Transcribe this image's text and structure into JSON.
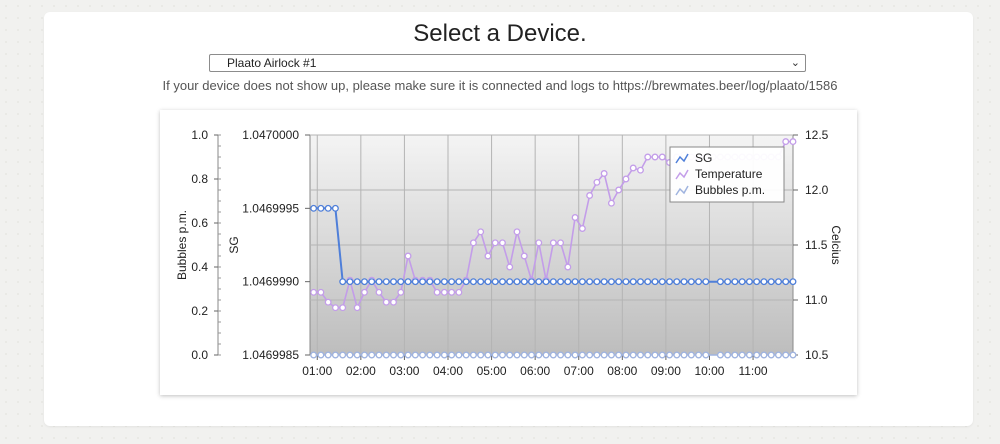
{
  "page": {
    "title": "Select a Device.",
    "device_select": {
      "selected": "Plaato Airlock #1"
    },
    "hint": "If your device does not show up, please make sure it is connected and logs to https://brewmates.beer/log/plaato/1586"
  },
  "colors": {
    "sg": "#4f7fd9",
    "temperature": "#c39de9",
    "bubbles": "#9fb3df",
    "plot_bg_top": "#f4f4f4",
    "plot_bg_bottom": "#bdbdbd"
  },
  "chart_data": {
    "type": "line",
    "x_ticks": [
      "01:00",
      "02:00",
      "03:00",
      "04:00",
      "05:00",
      "06:00",
      "07:00",
      "08:00",
      "09:00",
      "10:00",
      "11:00"
    ],
    "xlim": [
      "00:50",
      "11:55"
    ],
    "axes": {
      "bubbles": {
        "label": "Bubbles p.m.",
        "ylim": [
          0.0,
          1.0
        ],
        "ticks": [
          "0.0",
          "0.2",
          "0.4",
          "0.6",
          "0.8",
          "1.0"
        ]
      },
      "sg": {
        "label": "SG",
        "ylim": [
          1.0469985,
          1.047
        ],
        "ticks": [
          "1.0469985",
          "1.0469990",
          "1.0469995",
          "1.0470000"
        ]
      },
      "temperature": {
        "label": "Celcius",
        "ylim": [
          10.5,
          12.5
        ],
        "ticks": [
          "10.5",
          "11.0",
          "11.5",
          "12.0",
          "12.5"
        ]
      }
    },
    "legend": {
      "position": "top-right",
      "entries": [
        "SG",
        "Temperature",
        "Bubbles p.m."
      ]
    },
    "grid": true,
    "series": [
      {
        "name": "SG",
        "axis": "sg",
        "x": [
          "00:55",
          "01:05",
          "01:15",
          "01:25",
          "01:35",
          "01:45",
          "01:55",
          "02:05",
          "02:15",
          "02:25",
          "02:35",
          "02:45",
          "02:55",
          "03:05",
          "03:15",
          "03:25",
          "03:35",
          "03:45",
          "03:55",
          "04:05",
          "04:15",
          "04:25",
          "04:35",
          "04:45",
          "04:55",
          "05:05",
          "05:15",
          "05:25",
          "05:35",
          "05:45",
          "05:55",
          "06:05",
          "06:15",
          "06:25",
          "06:35",
          "06:45",
          "06:55",
          "07:05",
          "07:15",
          "07:25",
          "07:35",
          "07:45",
          "07:55",
          "08:05",
          "08:15",
          "08:25",
          "08:35",
          "08:45",
          "08:55",
          "09:05",
          "09:15",
          "09:25",
          "09:35",
          "09:45",
          "09:55",
          "10:15",
          "10:25",
          "10:35",
          "10:45",
          "10:55",
          "11:05",
          "11:15",
          "11:25",
          "11:35",
          "11:45",
          "11:55"
        ],
        "values": [
          1.0469995,
          1.0469995,
          1.0469995,
          1.0469995,
          1.046999,
          1.046999,
          1.046999,
          1.046999,
          1.046999,
          1.046999,
          1.046999,
          1.046999,
          1.046999,
          1.046999,
          1.046999,
          1.046999,
          1.046999,
          1.046999,
          1.046999,
          1.046999,
          1.046999,
          1.046999,
          1.046999,
          1.046999,
          1.046999,
          1.046999,
          1.046999,
          1.046999,
          1.046999,
          1.046999,
          1.046999,
          1.046999,
          1.046999,
          1.046999,
          1.046999,
          1.046999,
          1.046999,
          1.046999,
          1.046999,
          1.046999,
          1.046999,
          1.046999,
          1.046999,
          1.046999,
          1.046999,
          1.046999,
          1.046999,
          1.046999,
          1.046999,
          1.046999,
          1.046999,
          1.046999,
          1.046999,
          1.046999,
          1.046999,
          1.046999,
          1.046999,
          1.046999,
          1.046999,
          1.046999,
          1.046999,
          1.046999,
          1.046999,
          1.046999,
          1.046999,
          1.046999
        ]
      },
      {
        "name": "Temperature",
        "axis": "temperature",
        "x": [
          "00:55",
          "01:05",
          "01:15",
          "01:25",
          "01:35",
          "01:45",
          "01:55",
          "02:05",
          "02:15",
          "02:25",
          "02:35",
          "02:45",
          "02:55",
          "03:05",
          "03:15",
          "03:25",
          "03:35",
          "03:45",
          "03:55",
          "04:05",
          "04:15",
          "04:25",
          "04:35",
          "04:45",
          "04:55",
          "05:05",
          "05:15",
          "05:25",
          "05:35",
          "05:45",
          "05:55",
          "06:05",
          "06:15",
          "06:25",
          "06:35",
          "06:45",
          "06:55",
          "07:05",
          "07:15",
          "07:25",
          "07:35",
          "07:45",
          "07:55",
          "08:05",
          "08:15",
          "08:25",
          "08:35",
          "08:45",
          "08:55",
          "09:05",
          "09:15",
          "09:25",
          "09:35",
          "09:45",
          "09:55",
          "10:05",
          "10:15",
          "10:25",
          "10:35",
          "10:45",
          "10:55",
          "11:05",
          "11:15",
          "11:25",
          "11:35",
          "11:45",
          "11:55"
        ],
        "values": [
          11.07,
          11.07,
          10.98,
          10.93,
          10.93,
          11.18,
          10.93,
          11.07,
          11.18,
          11.07,
          10.98,
          10.98,
          11.07,
          11.4,
          11.18,
          11.18,
          11.18,
          11.07,
          11.07,
          11.07,
          11.07,
          11.18,
          11.52,
          11.62,
          11.4,
          11.52,
          11.52,
          11.3,
          11.62,
          11.4,
          11.18,
          11.52,
          11.18,
          11.52,
          11.52,
          11.3,
          11.75,
          11.65,
          11.95,
          12.07,
          12.15,
          11.88,
          12.0,
          12.1,
          12.2,
          12.18,
          12.3,
          12.3,
          12.3,
          12.25,
          12.3,
          12.32,
          12.3,
          12.3,
          12.3,
          12.3,
          12.3,
          12.3,
          12.3,
          12.3,
          12.3,
          12.3,
          12.3,
          12.3,
          12.3,
          12.44,
          12.44
        ]
      },
      {
        "name": "Bubbles p.m.",
        "axis": "bubbles",
        "x": [
          "00:55",
          "01:05",
          "01:15",
          "01:25",
          "01:35",
          "01:45",
          "01:55",
          "02:05",
          "02:15",
          "02:25",
          "02:35",
          "02:45",
          "02:55",
          "03:05",
          "03:15",
          "03:25",
          "03:35",
          "03:45",
          "03:55",
          "04:05",
          "04:15",
          "04:25",
          "04:35",
          "04:45",
          "04:55",
          "05:05",
          "05:15",
          "05:25",
          "05:35",
          "05:45",
          "05:55",
          "06:05",
          "06:15",
          "06:25",
          "06:35",
          "06:45",
          "06:55",
          "07:05",
          "07:15",
          "07:25",
          "07:35",
          "07:45",
          "07:55",
          "08:05",
          "08:15",
          "08:25",
          "08:35",
          "08:45",
          "08:55",
          "09:05",
          "09:15",
          "09:25",
          "09:35",
          "09:45",
          "09:55",
          "10:15",
          "10:25",
          "10:35",
          "10:45",
          "10:55",
          "11:05",
          "11:15",
          "11:25",
          "11:35",
          "11:45",
          "11:55"
        ],
        "values": [
          0,
          0,
          0,
          0,
          0,
          0,
          0,
          0,
          0,
          0,
          0,
          0,
          0,
          0,
          0,
          0,
          0,
          0,
          0,
          0,
          0,
          0,
          0,
          0,
          0,
          0,
          0,
          0,
          0,
          0,
          0,
          0,
          0,
          0,
          0,
          0,
          0,
          0,
          0,
          0,
          0,
          0,
          0,
          0,
          0,
          0,
          0,
          0,
          0,
          0,
          0,
          0,
          0,
          0,
          0,
          0,
          0,
          0,
          0,
          0,
          0,
          0,
          0,
          0,
          0,
          0
        ]
      }
    ]
  }
}
